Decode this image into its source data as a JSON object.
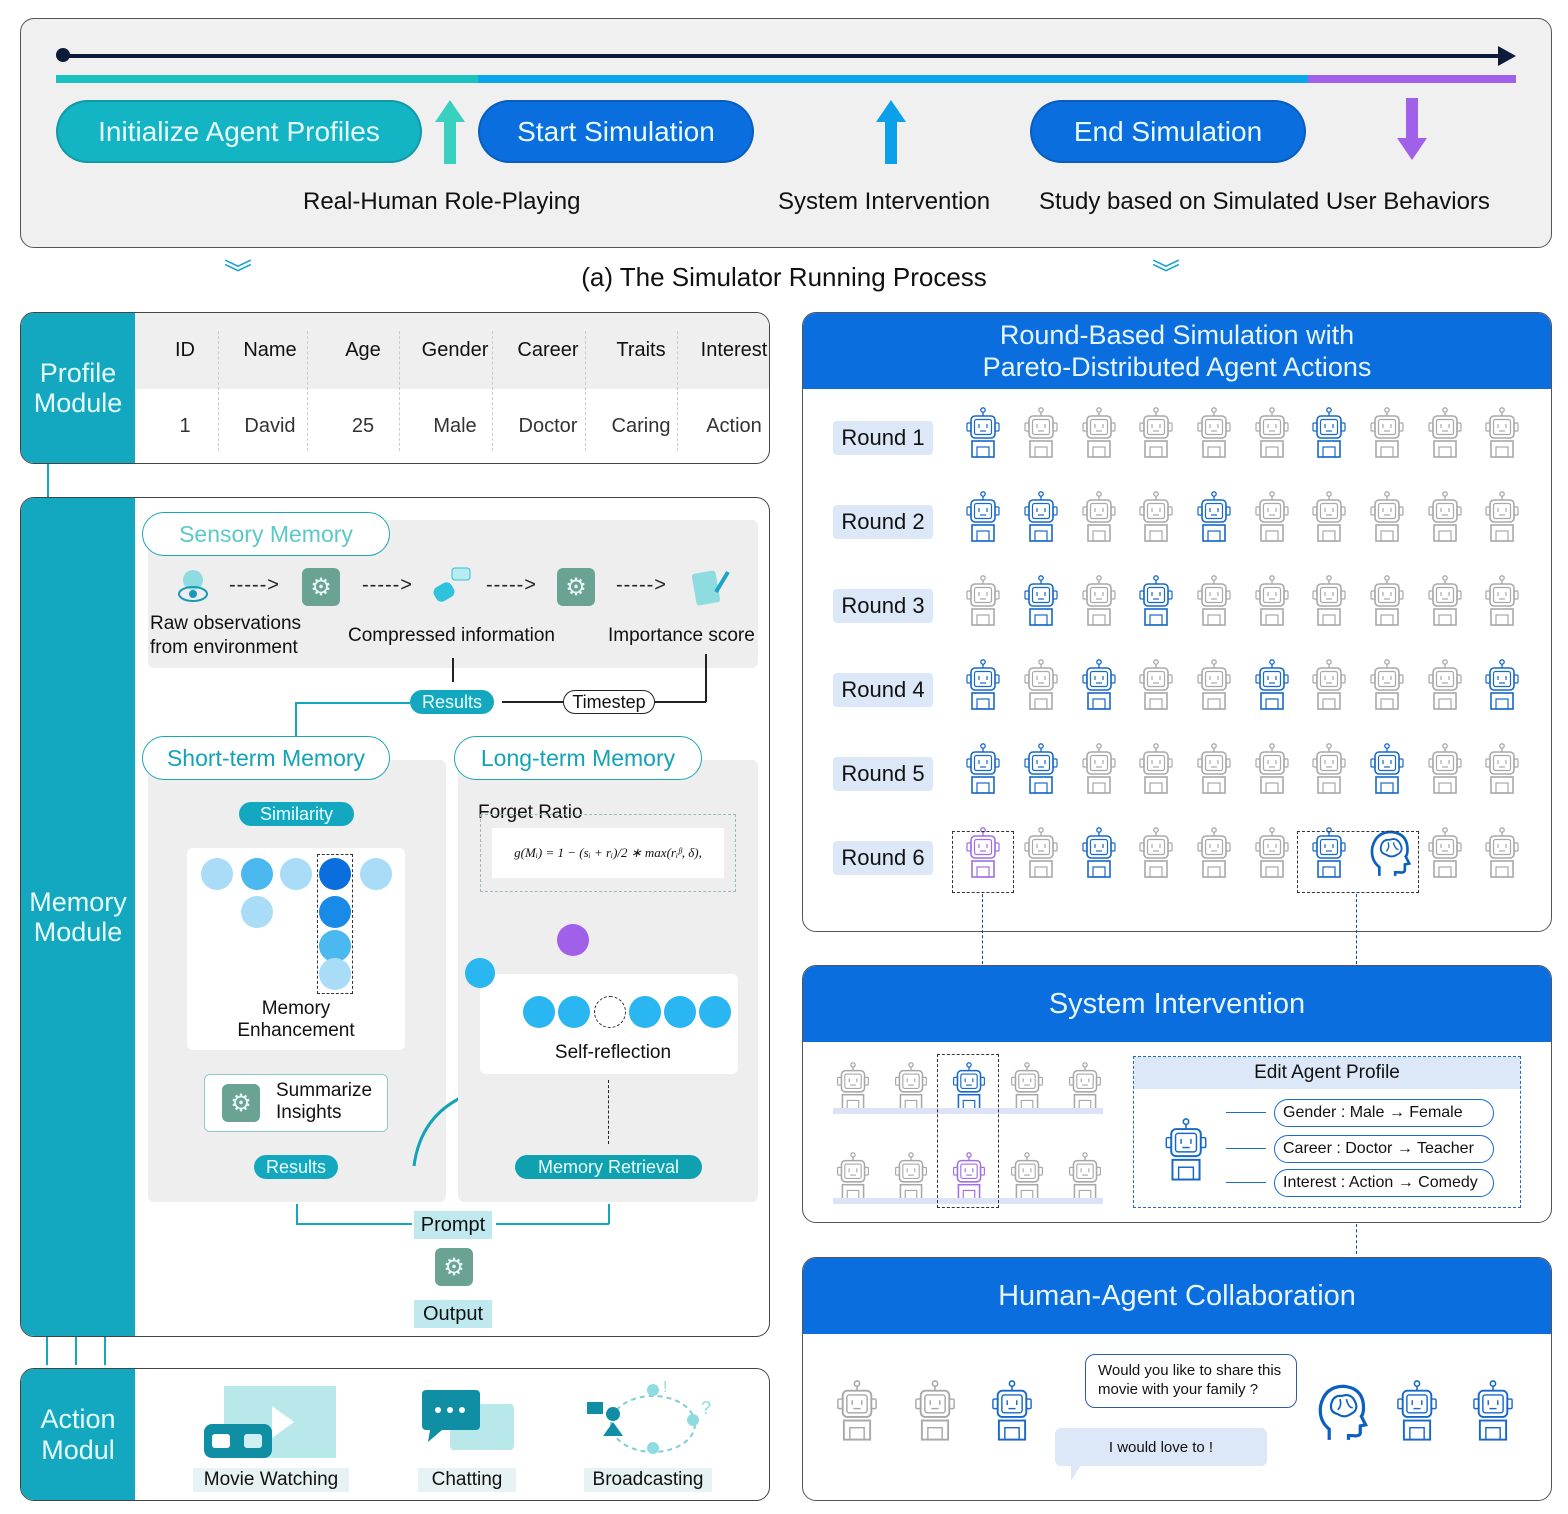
{
  "timeline": {
    "buttons": [
      "Initialize Agent Profiles",
      "Start Simulation",
      "End Simulation"
    ],
    "labels": [
      "Real-Human Role-Playing",
      "System Intervention",
      "Study based on Simulated User Behaviors"
    ],
    "colors": {
      "teal": "#1cc2c0",
      "blue": "#0a6ede",
      "sky": "#0aa5ea",
      "purple": "#a060ea",
      "navy": "#0d1b3a"
    }
  },
  "caption": "(a) The Simulator Running Process",
  "profile_module": {
    "title": "Profile Module",
    "headers": [
      "ID",
      "Name",
      "Age",
      "Gender",
      "Career",
      "Traits",
      "Interest"
    ],
    "row": [
      "1",
      "David",
      "25",
      "Male",
      "Doctor",
      "Caring",
      "Action"
    ]
  },
  "memory_module": {
    "title": "Memory Module",
    "sensory": {
      "title": "Sensory Memory",
      "raw_label_1": "Raw observations",
      "raw_label_2": "from environment",
      "compressed_label": "Compressed information",
      "importance_label": "Importance score",
      "results": "Results",
      "timestep": "Timestep",
      "arrow": "----->"
    },
    "short_term": {
      "title": "Short-term Memory",
      "similarity": "Similarity",
      "enhancement_1": "Memory",
      "enhancement_2": "Enhancement",
      "summarize_1": "Summarize",
      "summarize_2": "Insights",
      "results": "Results"
    },
    "long_term": {
      "title": "Long-term Memory",
      "forget_ratio": "Forget Ratio",
      "formula": "g(Mᵢ) = 1 − (sᵢ + rᵢ)/2 ∗ max(rᵢᵝ, δ),",
      "self_reflection": "Self-reflection",
      "retrieval": "Memory Retrieval"
    },
    "prompt": "Prompt",
    "output": "Output"
  },
  "action_module": {
    "title": "Action Modul",
    "actions": [
      "Movie Watching",
      "Chatting",
      "Broadcasting"
    ]
  },
  "round_panel": {
    "title_1": "Round-Based Simulation with",
    "title_2": "Pareto-Distributed Agent Actions",
    "rounds": [
      {
        "label": "Round 1",
        "active": [
          0,
          6
        ]
      },
      {
        "label": "Round 2",
        "active": [
          0,
          1,
          4
        ]
      },
      {
        "label": "Round 3",
        "active": [
          1,
          3
        ]
      },
      {
        "label": "Round 4",
        "active": [
          0,
          2,
          5,
          9
        ]
      },
      {
        "label": "Round 5",
        "active": [
          0,
          1,
          7
        ]
      },
      {
        "label": "Round 6",
        "active": [
          2,
          6
        ],
        "modified": [
          0
        ],
        "human": [
          7
        ]
      }
    ]
  },
  "intervention_panel": {
    "title": "System Intervention",
    "edit_title": "Edit Agent Profile",
    "edits": [
      "Gender : Male → Female",
      "Career : Doctor → Teacher",
      "Interest : Action → Comedy"
    ]
  },
  "collab_panel": {
    "title": "Human-Agent Collaboration",
    "question_1": "Would you like to share this",
    "question_2": "movie with your family ?",
    "answer": "I would love to !"
  }
}
